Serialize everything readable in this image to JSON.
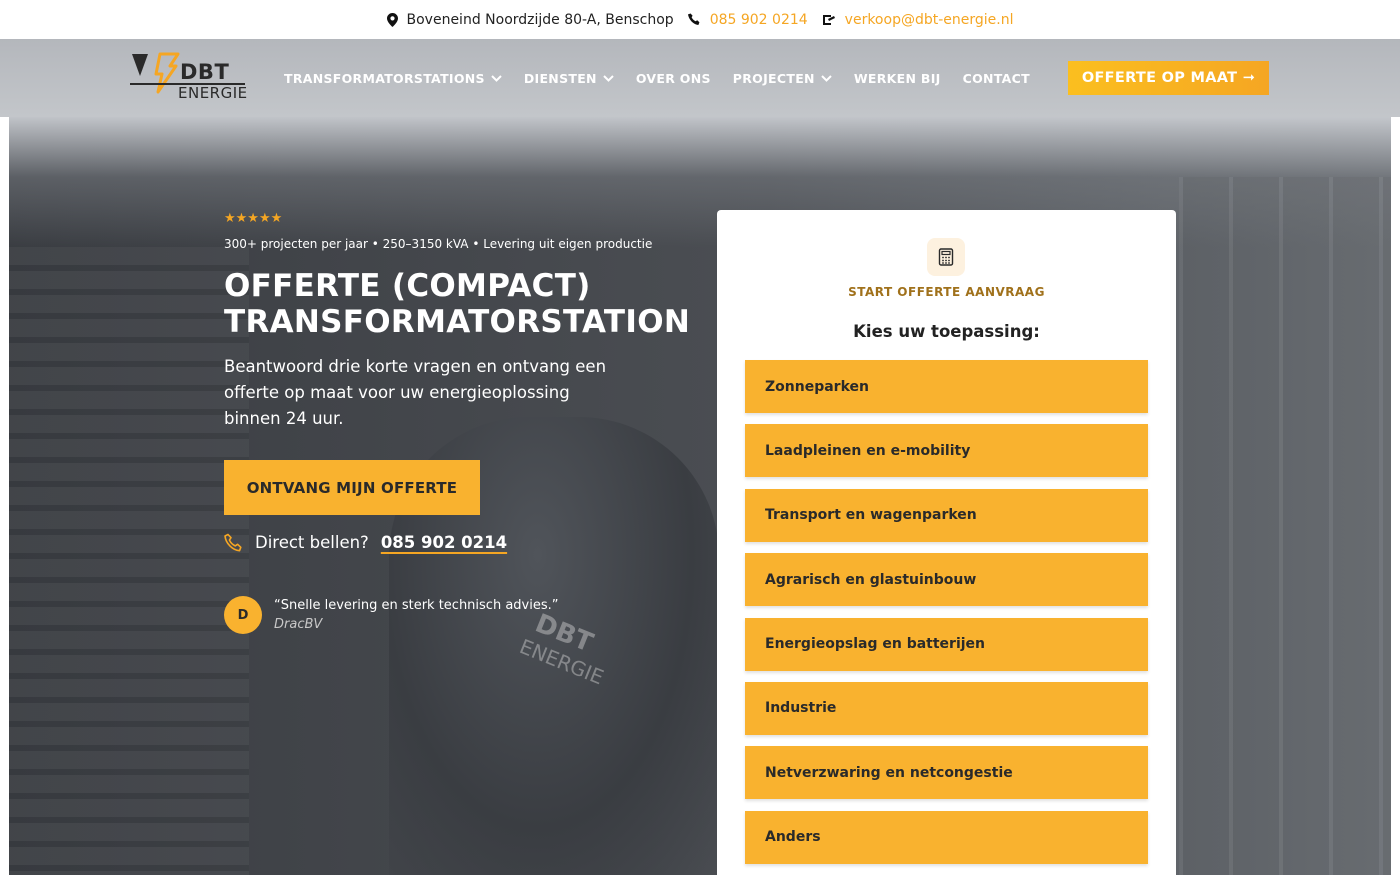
{
  "topbar": {
    "address": "Boveneind Noordzijde 80-A, Benschop",
    "phone": "085 902 0214",
    "email": "verkoop@dbt-energie.nl"
  },
  "logo": {
    "brand": "DBT",
    "sub": "ENERGIE"
  },
  "nav": {
    "items": [
      {
        "label": "TRANSFORMATORSTATIONS",
        "dropdown": true
      },
      {
        "label": "DIENSTEN",
        "dropdown": true
      },
      {
        "label": "OVER ONS",
        "dropdown": false
      },
      {
        "label": "PROJECTEN",
        "dropdown": true
      },
      {
        "label": "WERKEN BIJ",
        "dropdown": false
      },
      {
        "label": "CONTACT",
        "dropdown": false
      }
    ],
    "cta": "OFFERTE OP MAAT ➞"
  },
  "hero": {
    "rating": "★★★★★",
    "usp": "300+ projecten per jaar • 250–3150 kVA • Levering uit eigen productie",
    "title_line1": "OFFERTE (COMPACT)",
    "title_line2": "TRANSFORMATORSTATION",
    "subtitle": "Beantwoord drie korte vragen en ontvang een offerte op maat voor uw energieoplossing binnen 24 uur.",
    "cta": "ONTVANG MIJN OFFERTE",
    "call_prefix": "Direct bellen?",
    "call_number": "085 902 0214",
    "review": {
      "initial": "D",
      "quote": "“Snelle levering en sterk technisch advies.”",
      "author": "DracBV"
    },
    "shirt_logo_a": "DBT",
    "shirt_logo_b": "ENERGIE"
  },
  "form": {
    "kicker": "START OFFERTE AANVRAAG",
    "heading": "Kies uw toepassing:",
    "options": [
      "Zonneparken",
      "Laadpleinen en e-mobility",
      "Transport en wagenparken",
      "Agrarisch en glastuinbouw",
      "Energieopslag en batterijen",
      "Industrie",
      "Netverzwaring en netcongestie",
      "Anders"
    ]
  },
  "colors": {
    "accent": "#f9b22f",
    "accent_text": "#f5a623",
    "kicker": "#a0711b",
    "dark_text": "#2a2a2a"
  },
  "icons": [
    "location-pin-icon",
    "phone-icon",
    "email-icon",
    "chevron-down-icon",
    "calculator-icon",
    "phone-outline-icon",
    "logo-bolt-icon"
  ]
}
